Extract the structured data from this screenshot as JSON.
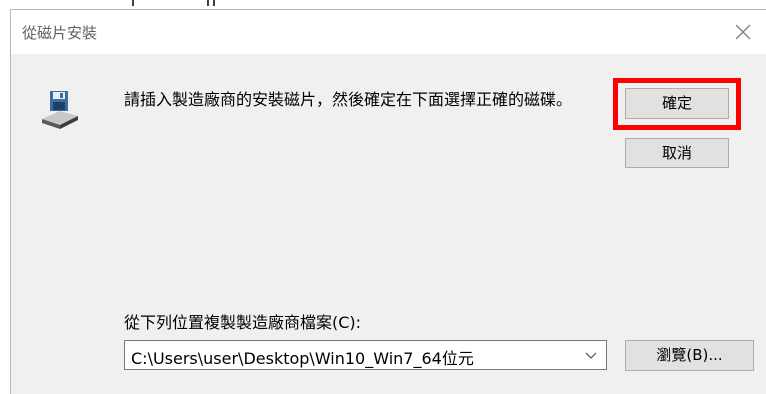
{
  "dialog": {
    "title": "從磁片安裝",
    "close_label": "✕",
    "message": "請插入製造廠商的安裝磁片，然後確定在下面選擇正確的磁碟。",
    "ok_label": "確定",
    "cancel_label": "取消",
    "copy_from_label": "從下列位置複製製造廠商檔案(C):",
    "path_value": "C:\\Users\\user\\Desktop\\Win10_Win7_64位元",
    "browse_label": "瀏覽(B)..."
  },
  "colors": {
    "highlight": "#ff0000",
    "button_face": "#e1e1e1",
    "dialog_body": "#f0f0f0"
  },
  "icons": {
    "disk": "floppy-drive-icon",
    "dropdown": "chevron-down-icon",
    "close": "close-icon"
  }
}
